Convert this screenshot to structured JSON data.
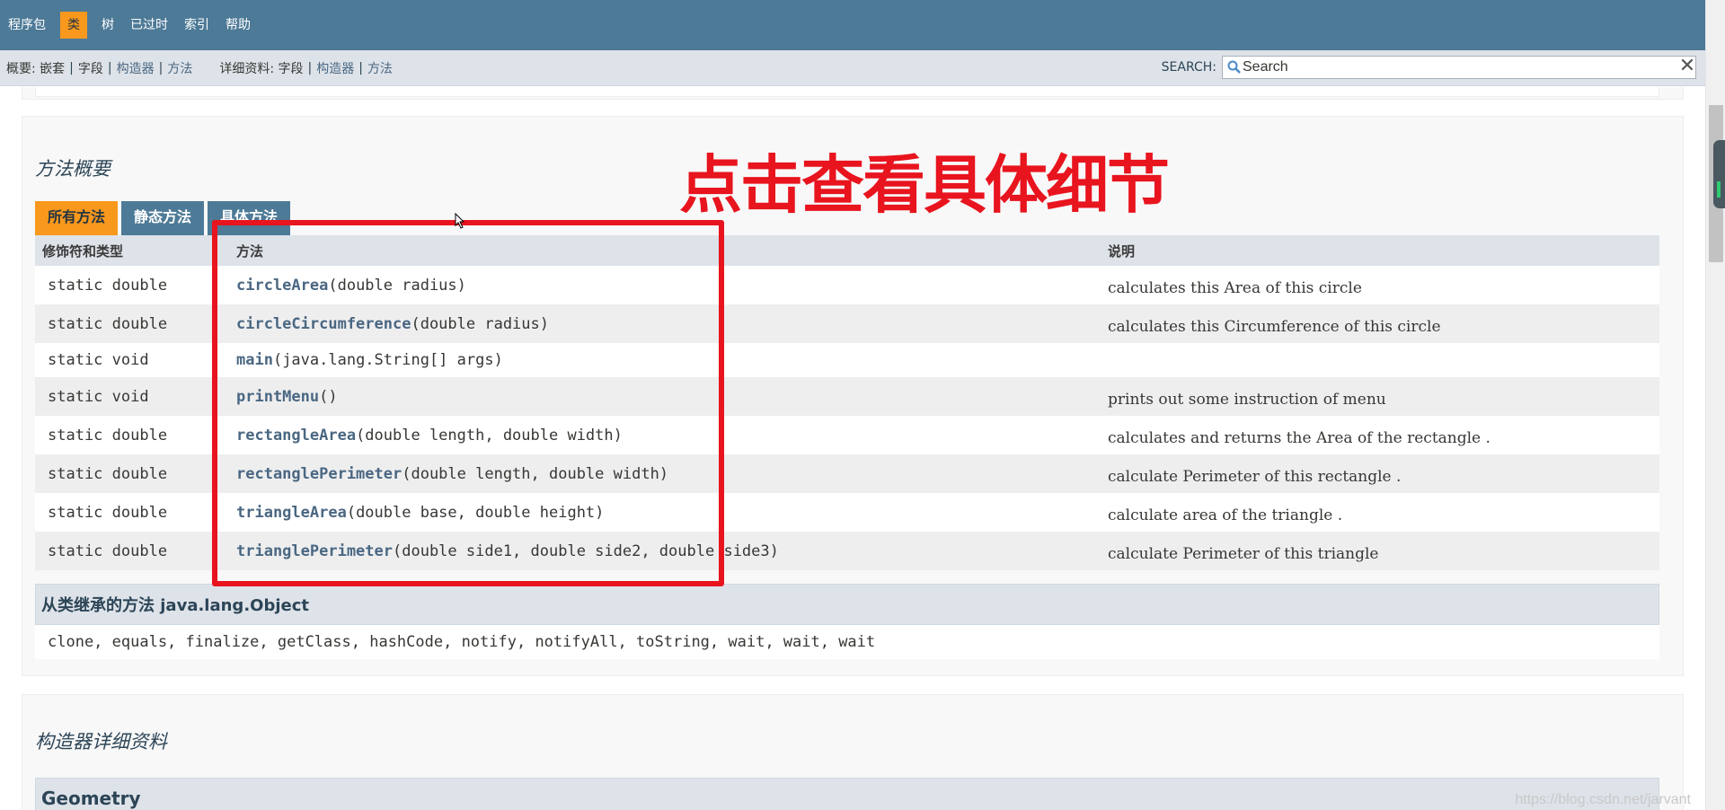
{
  "topnav": {
    "items": [
      "程序包",
      "类",
      "树",
      "已过时",
      "索引",
      "帮助"
    ],
    "active_index": 1
  },
  "subnav": {
    "summary_prefix": "概要:",
    "summary_items": [
      "嵌套",
      "字段",
      "构造器",
      "方法"
    ],
    "detail_prefix": "详细资料:",
    "detail_items": [
      "字段",
      "构造器",
      "方法"
    ],
    "sep": "|",
    "search_label": "SEARCH:",
    "search_placeholder": "Search",
    "clear_glyph": "✕"
  },
  "method_summary": {
    "title": "方法概要",
    "tabs": [
      "所有方法",
      "静态方法",
      "具体方法"
    ],
    "active_tab": 0,
    "headers": [
      "修饰符和类型",
      "方法",
      "说明"
    ],
    "rows": [
      {
        "modifier": "static double",
        "name": "circleArea",
        "params": "(double radius)",
        "desc": "calculates this Area of this circle"
      },
      {
        "modifier": "static double",
        "name": "circleCircumference",
        "params": "(double radius)",
        "desc": "calculates this Circumference of this circle"
      },
      {
        "modifier": "static void",
        "name": "main",
        "params": "(java.lang.String[] args)",
        "desc": ""
      },
      {
        "modifier": "static void",
        "name": "printMenu",
        "params": "()",
        "desc": "prints out some instruction of menu"
      },
      {
        "modifier": "static double",
        "name": "rectangleArea",
        "params": "(double length, double width)",
        "desc": "calculates and returns the Area of the rectangle ."
      },
      {
        "modifier": "static double",
        "name": "rectanglePerimeter",
        "params": "(double length, double width)",
        "desc": "calculate Perimeter of this rectangle ."
      },
      {
        "modifier": "static double",
        "name": "triangleArea",
        "params": "(double base, double height)",
        "desc": "calculate area of the triangle ."
      },
      {
        "modifier": "static double",
        "name": "trianglePerimeter",
        "params": "(double side1, double side2, double side3)",
        "desc": "calculate Perimeter of this triangle"
      }
    ],
    "inherited_title": "从类继承的方法 java.lang.Object",
    "inherited_methods": "clone, equals, finalize, getClass, hashCode, notify, notifyAll, toString, wait, wait, wait"
  },
  "constructor_detail": {
    "title": "构造器详细资料",
    "class_name": "Geometry"
  },
  "annotation": {
    "text": "点击查看具体细节",
    "color": "#e8141e"
  },
  "watermark": "https://blog.csdn.net/jarvant",
  "colors": {
    "nav_bg": "#4d7a97",
    "active_orange": "#f8981d",
    "link": "#4a6782"
  }
}
